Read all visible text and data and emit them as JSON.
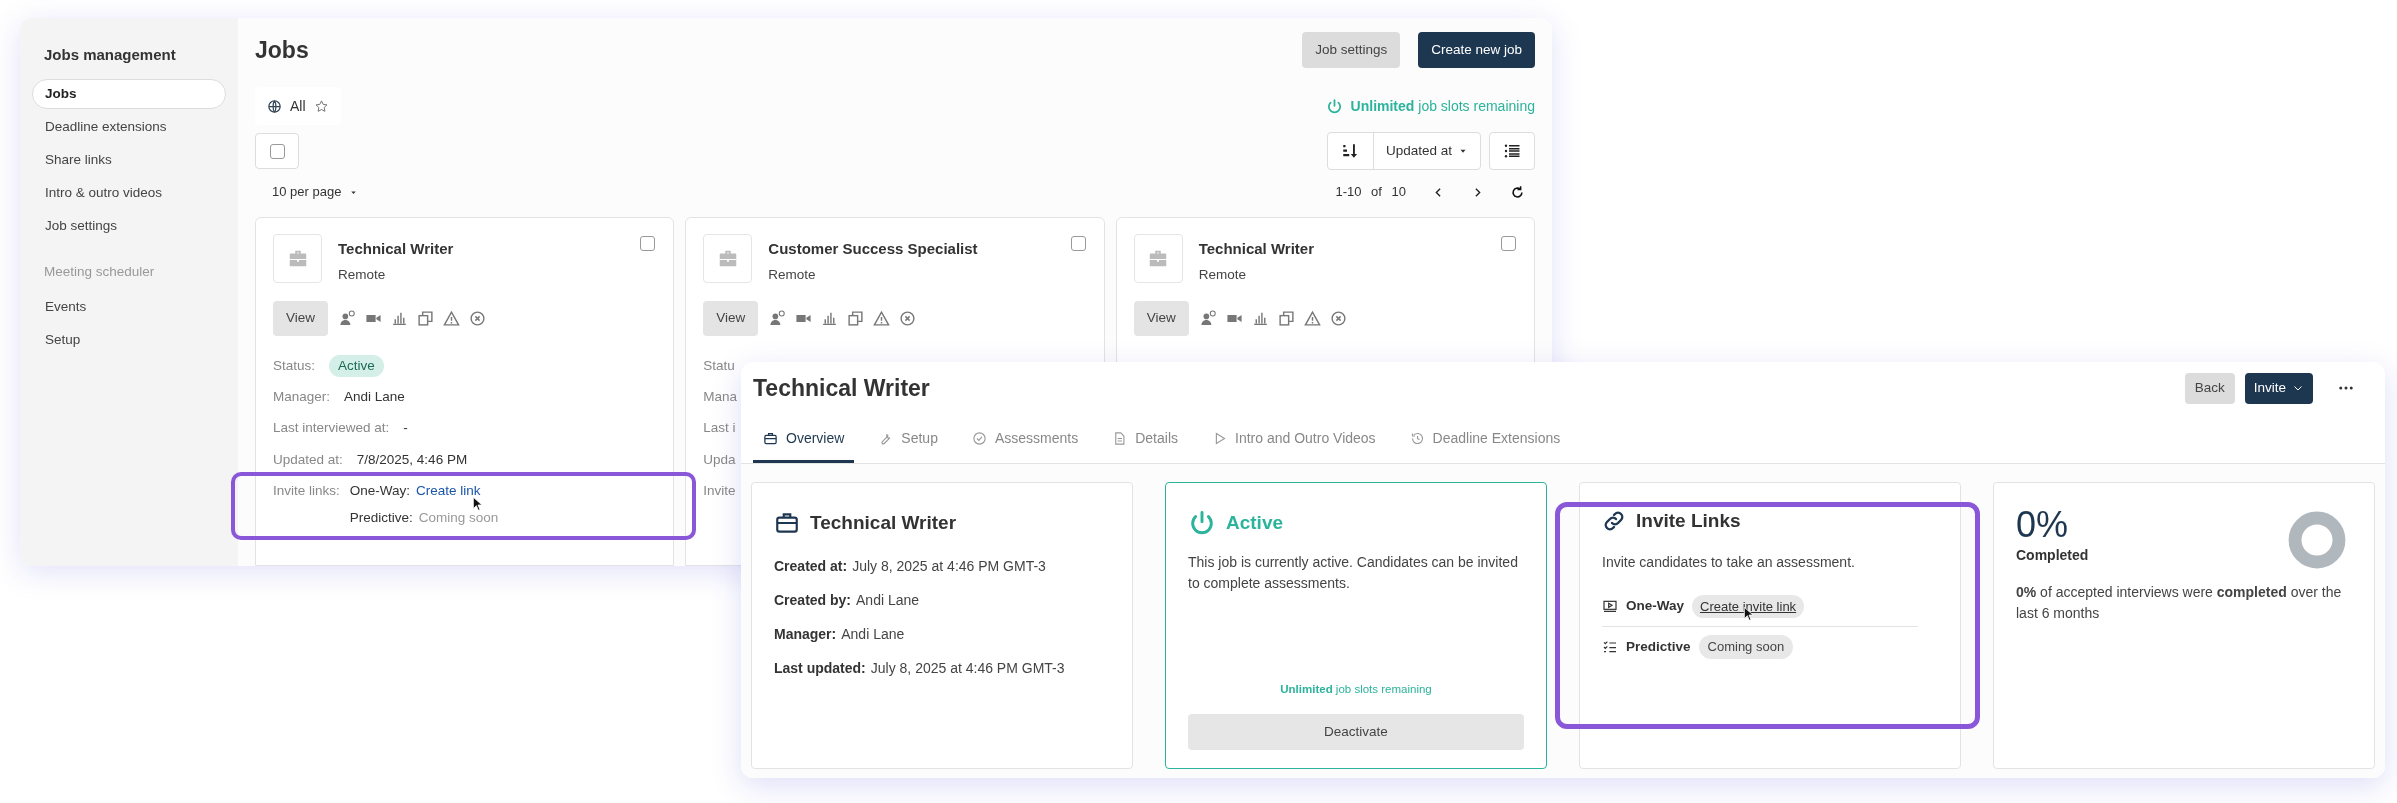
{
  "jobs_window": {
    "sidebar": {
      "title": "Jobs management",
      "groups": [
        {
          "items": [
            {
              "label": "Jobs",
              "selected": true
            },
            {
              "label": "Deadline extensions",
              "selected": false
            },
            {
              "label": "Share links",
              "selected": false
            },
            {
              "label": "Intro & outro videos",
              "selected": false
            },
            {
              "label": "Job settings",
              "selected": false
            }
          ]
        },
        {
          "heading": "Meeting scheduler",
          "items": [
            {
              "label": "Events",
              "selected": false
            },
            {
              "label": "Setup",
              "selected": false
            }
          ]
        }
      ]
    },
    "title": "Jobs",
    "buttons": [
      {
        "label": "Job settings",
        "kind": "secondary"
      },
      {
        "label": "Create new job",
        "kind": "primary"
      }
    ],
    "filter_tabs": [
      {
        "label": "All",
        "selected": true
      }
    ],
    "slots": "**Unlimited** job slots remaining",
    "select_all": {
      "checked": false
    },
    "sort": {
      "label": "Updated at"
    },
    "per_page": "10 per page",
    "pagination": "1-10 of 10",
    "cards": [
      {
        "title": "Technical Writer",
        "location": "Remote",
        "checked": false,
        "action": "View",
        "rows": [
          {
            "kind": "badge",
            "label": "Status:",
            "value": "Active"
          },
          {
            "kind": "text",
            "label": "Manager:",
            "value": "Andi Lane"
          },
          {
            "kind": "text",
            "label": "Last interviewed at:",
            "value": "-"
          },
          {
            "kind": "text",
            "label": "Updated at:",
            "value": "7/8/2025, 4:46 PM"
          },
          {
            "kind": "links",
            "label": "Invite links:",
            "links": [
              {
                "label": "One-Way:",
                "value": "Create link",
                "kind": "link"
              },
              {
                "label": "Predictive:",
                "value": "Coming soon",
                "kind": "muted"
              }
            ]
          }
        ]
      },
      {
        "title": "Customer Success Specialist",
        "location": "Remote",
        "checked": false,
        "action": "View",
        "rows": [
          {
            "kind": "label",
            "label": "Statu"
          },
          {
            "kind": "label",
            "label": "Mana"
          },
          {
            "kind": "label",
            "label": "Last i"
          },
          {
            "kind": "label",
            "label": "Upda"
          },
          {
            "kind": "label",
            "label": "Invite"
          }
        ]
      },
      {
        "title": "Technical Writer",
        "location": "Remote",
        "checked": false,
        "action": "View"
      }
    ]
  },
  "detail_window": {
    "title": "Technical Writer",
    "buttons": [
      {
        "label": "Back",
        "kind": "secondary"
      },
      {
        "label": "Invite",
        "kind": "dropdown"
      }
    ],
    "tabs": [
      {
        "label": "Overview",
        "selected": true
      },
      {
        "label": "Setup",
        "selected": false
      },
      {
        "label": "Assessments",
        "selected": false
      },
      {
        "label": "Details",
        "selected": false
      },
      {
        "label": "Intro and Outro Videos",
        "selected": false
      },
      {
        "label": "Deadline Extensions",
        "selected": false
      }
    ],
    "cards": [
      {
        "kind": "info",
        "title": "Technical Writer",
        "fields": [
          {
            "label": "Created at:",
            "value": "July 8, 2025 at 4:46 PM GMT-3"
          },
          {
            "label": "Created by:",
            "value": "Andi Lane"
          },
          {
            "label": "Manager:",
            "value": "Andi Lane"
          },
          {
            "label": "Last updated:",
            "value": "July 8, 2025 at 4:46 PM GMT-3"
          }
        ]
      },
      {
        "kind": "status",
        "title": "Active",
        "text": "This job is currently active. Candidates can be invited to complete assessments.",
        "slots": "**Unlimited** job slots remaining",
        "button": "Deactivate"
      },
      {
        "kind": "links",
        "title": "Invite Links",
        "text": "Invite candidates to take an assessment.",
        "links": [
          {
            "label": "One-Way",
            "value": "Create invite link",
            "kind": "link"
          },
          {
            "label": "Predictive",
            "value": "Coming soon",
            "kind": "muted"
          }
        ]
      },
      {
        "kind": "metric",
        "value": "0%",
        "label": "Completed",
        "text": "**0%** of accepted interviews were **completed** over the last 6 months"
      }
    ]
  }
}
